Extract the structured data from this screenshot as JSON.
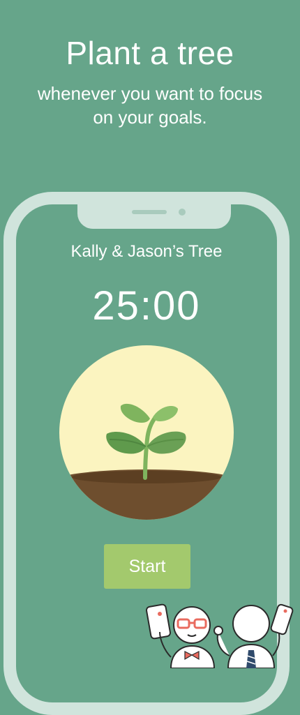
{
  "headline": "Plant a tree",
  "subheadline": "whenever you want to focus on your goals.",
  "screen": {
    "tree_name": "Kally & Jason’s Tree",
    "timer": "25:00",
    "start_label": "Start"
  },
  "colors": {
    "background": "#66a58a",
    "phone_frame": "#d0e4dc",
    "circle": "#fbf4c0",
    "soil": "#6e4e2e",
    "leaf": "#6aa055",
    "button": "#a3c96d"
  },
  "icons": {
    "plant": "sprout-icon",
    "characters": "mascot-characters-illustration"
  }
}
